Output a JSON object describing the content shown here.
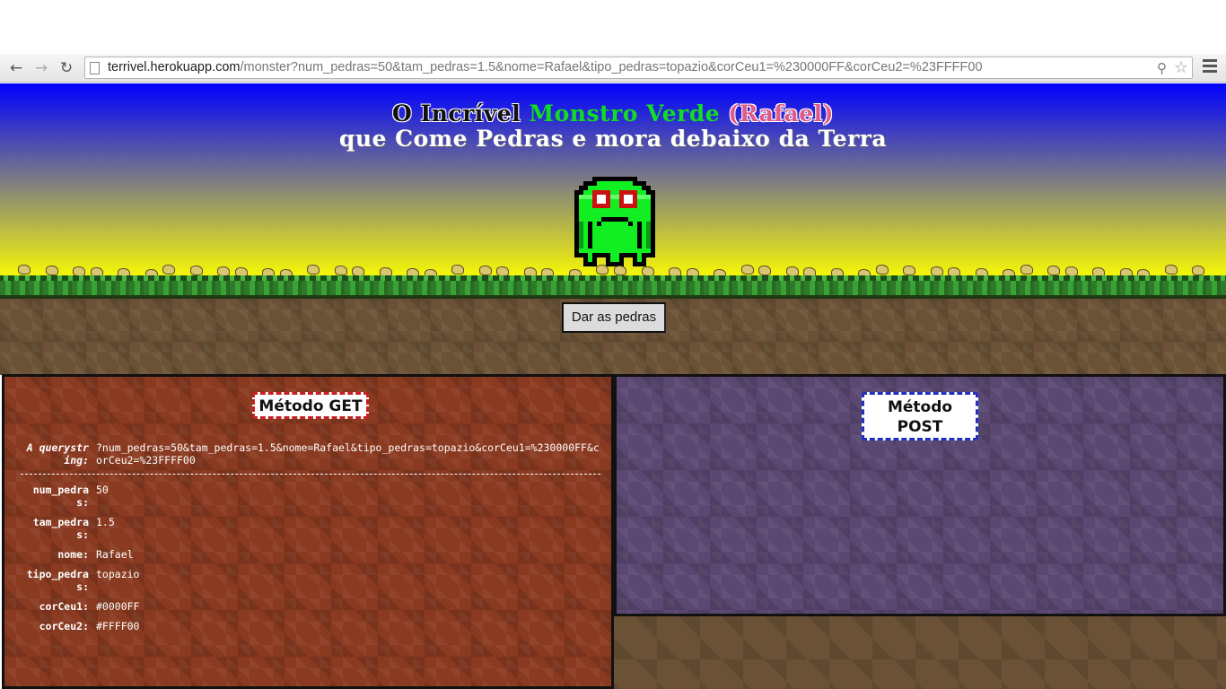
{
  "browser": {
    "url_host": "terrivel.herokuapp.com",
    "url_path": "/monster?num_pedras=50&tam_pedras=1.5&nome=Rafael&tipo_pedras=topazio&corCeu1=%230000FF&corCeu2=%23FFFF00",
    "back_icon": "back-arrow-icon",
    "forward_icon": "forward-arrow-icon",
    "reload_icon": "reload-icon"
  },
  "title": {
    "w1": "O Incrível",
    "w2": "Monstro Verde",
    "w3": "(Rafael)",
    "line2": "que Come Pedras e mora debaixo da Terra"
  },
  "sky": {
    "color_top": "#0000FF",
    "color_bottom": "#FFFF00"
  },
  "give_button": "Dar as pedras",
  "get": {
    "label": "Método GET",
    "query_label": "A querystring:",
    "query_value": "?num_pedras=50&tam_pedras=1.5&nome=Rafael&tipo_pedras=topazio&corCeu1=%230000FF&corCeu2=%23FFFF00",
    "params": [
      {
        "key": "num_pedras:",
        "value": "50"
      },
      {
        "key": "tam_pedras:",
        "value": "1.5"
      },
      {
        "key": "nome:",
        "value": "Rafael"
      },
      {
        "key": "tipo_pedras:",
        "value": "topazio"
      },
      {
        "key": "corCeu1:",
        "value": "#0000FF"
      },
      {
        "key": "corCeu2:",
        "value": "#FFFF00"
      }
    ]
  },
  "post": {
    "label_line1": "Método",
    "label_line2": "POST"
  },
  "monster": {
    "color": "#11ee22",
    "eye_color": "#cc1111"
  },
  "stones": {
    "count": 50,
    "type": "topazio",
    "size": 1.5,
    "color": "#d9c66e"
  }
}
